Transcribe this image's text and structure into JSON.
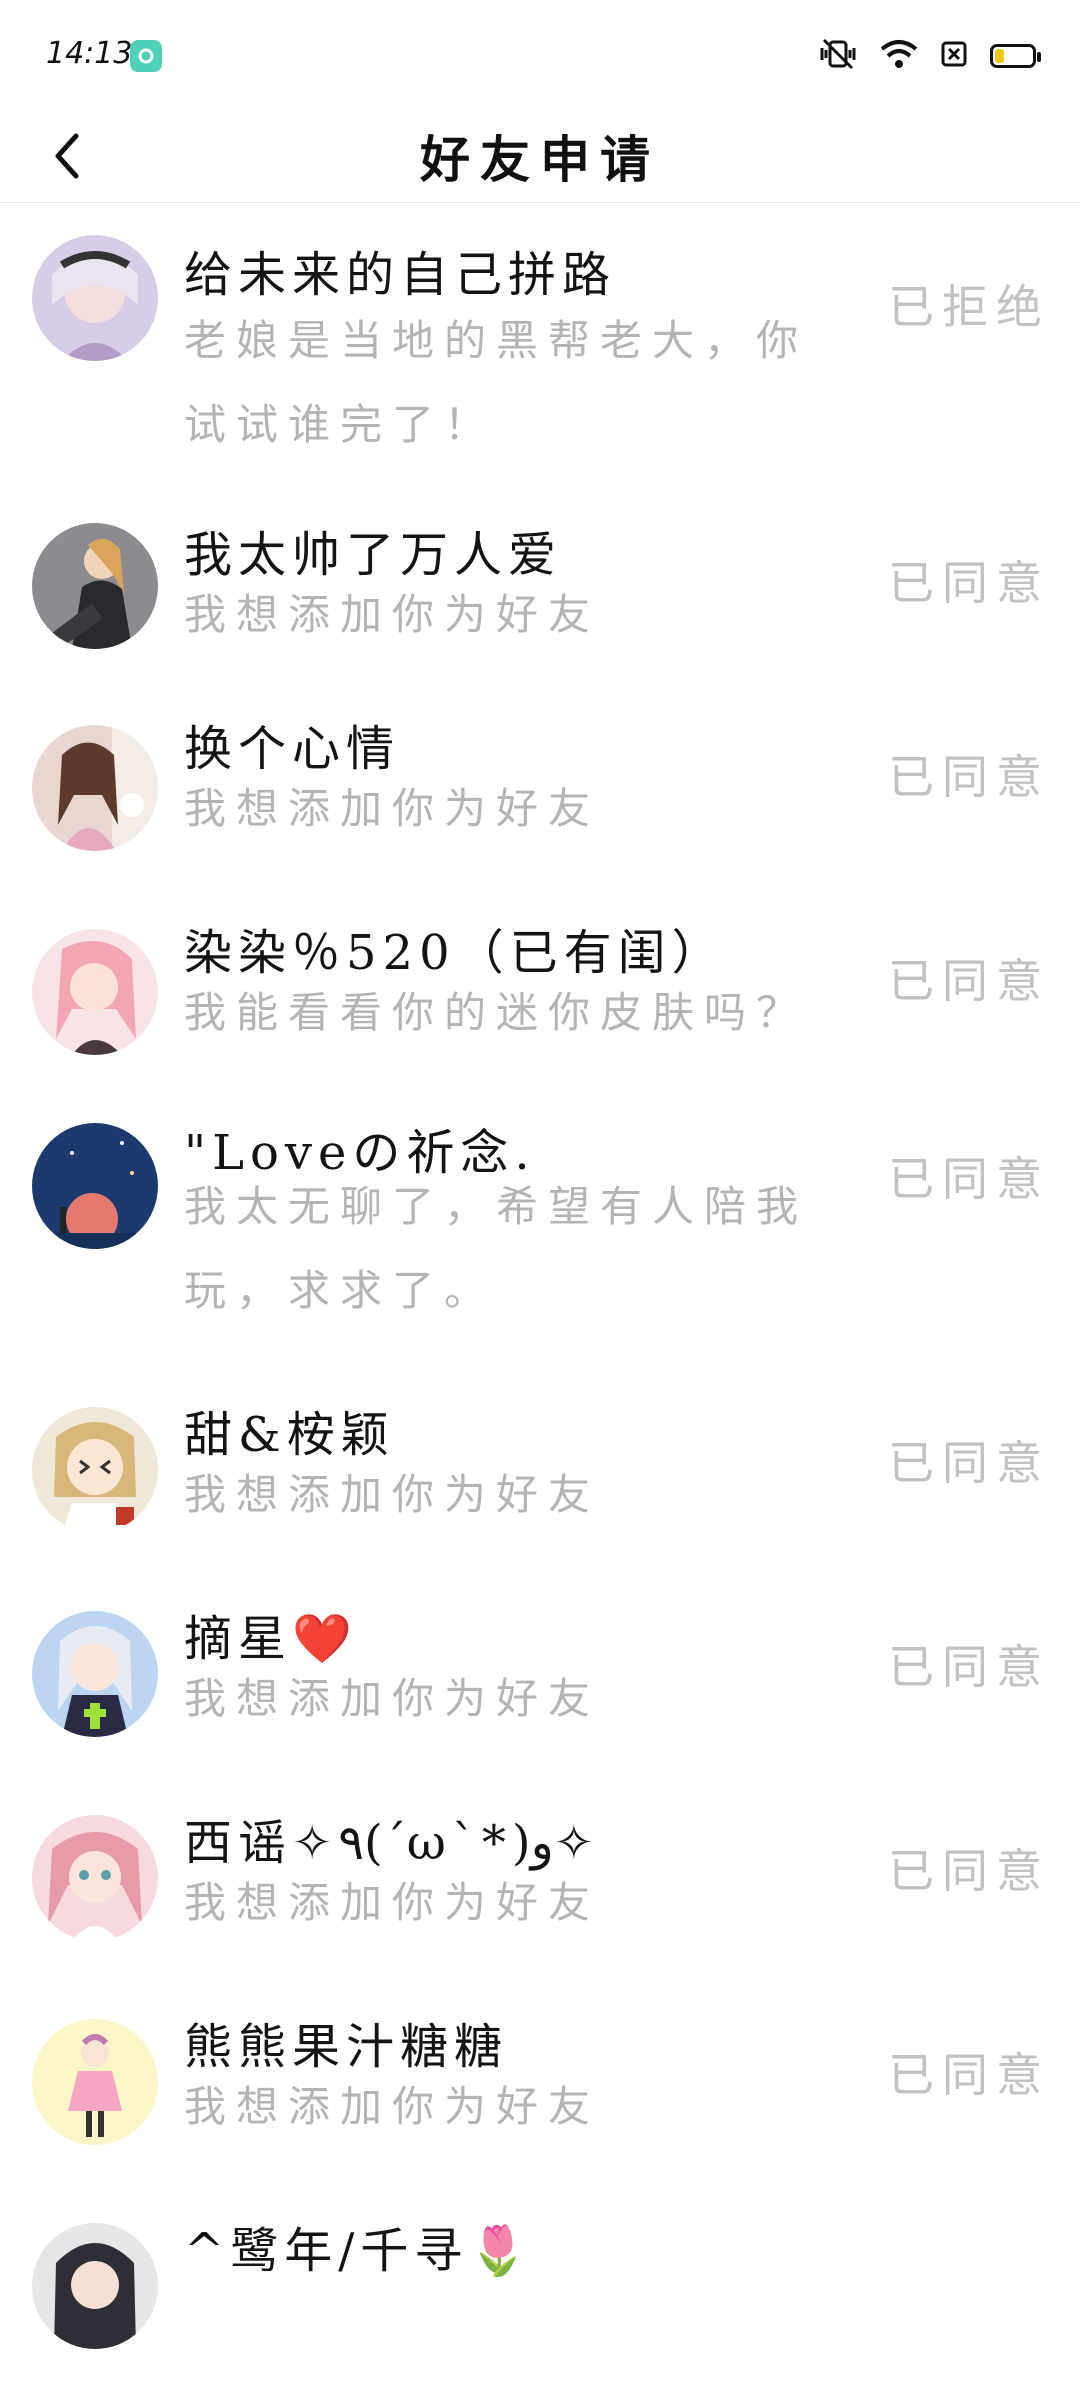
{
  "status_bar": {
    "time": "14:13",
    "icons": [
      "app-notification-icon",
      "vibrate-mute-icon",
      "wifi-icon",
      "sim-icon",
      "battery-icon"
    ],
    "battery_level": 0.25
  },
  "header": {
    "title": "好友申请",
    "back_icon": "chevron-left-icon"
  },
  "requests": [
    {
      "name": "给未来的自己拼路",
      "message": "老娘是当地的黑帮老大，你试试谁完了！",
      "status": "已拒绝"
    },
    {
      "name": "我太帅了万人爱",
      "message": "我想添加你为好友",
      "status": "已同意"
    },
    {
      "name": "换个心情",
      "message": "我想添加你为好友",
      "status": "已同意"
    },
    {
      "name": "染染％520（已有闺）",
      "message": "我能看看你的迷你皮肤吗？",
      "status": "已同意"
    },
    {
      "name": "\"Loveの祈念.",
      "message": "我太无聊了，希望有人陪我玩，求求了。",
      "status": "已同意"
    },
    {
      "name": "甜&桉颖",
      "message": "我想添加你为好友",
      "status": "已同意"
    },
    {
      "name": "摘星❤️",
      "message": "我想添加你为好友",
      "status": "已同意"
    },
    {
      "name": "西谣✧٩(ˊωˋ*)و✧",
      "message": "我想添加你为好友",
      "status": "已同意"
    },
    {
      "name": "熊熊果汁糖糖",
      "message": "我想添加你为好友",
      "status": "已同意"
    },
    {
      "name": "^鹭年/千寻🌷",
      "message": "",
      "status": ""
    }
  ],
  "colors": {
    "name": "#141414",
    "message": "#b4b4b4",
    "status": "#c2c2c2",
    "divider": "#e6e6e6",
    "app_icon": "#4fd1b8",
    "battery": "#f5c518"
  }
}
